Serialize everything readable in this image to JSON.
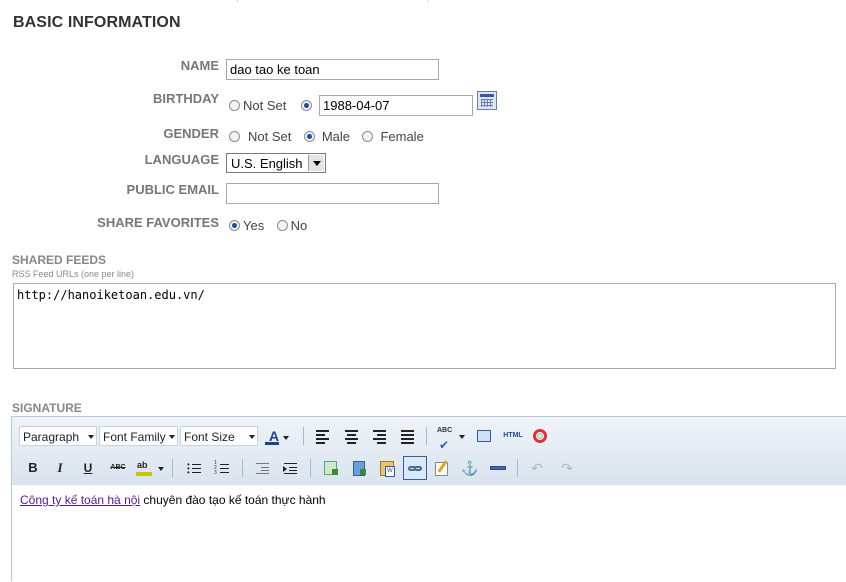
{
  "section_title": "BASIC INFORMATION",
  "form": {
    "name": {
      "label": "NAME",
      "value": "dao tao ke toan"
    },
    "birthday": {
      "label": "BIRTHDAY",
      "not_set_label": "Not Set",
      "value": "1988-04-07"
    },
    "gender": {
      "label": "GENDER",
      "options": [
        "Not Set",
        "Male",
        "Female"
      ],
      "selected": "Male"
    },
    "language": {
      "label": "LANGUAGE",
      "value": "U.S. English"
    },
    "public_email": {
      "label": "PUBLIC EMAIL",
      "value": ""
    },
    "share_favorites": {
      "label": "SHARE FAVORITES",
      "options": [
        "Yes",
        "No"
      ],
      "selected": "Yes"
    }
  },
  "shared_feeds": {
    "title": "SHARED FEEDS",
    "subtitle": "RSS Feed URLs (one per line)",
    "value": "http://hanoiketoan.edu.vn/"
  },
  "signature": {
    "title": "SIGNATURE",
    "toolbar": {
      "paragraph": "Paragraph",
      "font_family": "Font Family",
      "font_size": "Font Size",
      "icons_row1": [
        "text-color-icon",
        "align-left-icon",
        "align-center-icon",
        "align-right-icon",
        "align-justify-icon",
        "spellcheck-icon",
        "fullscreen-icon",
        "html-source-icon",
        "help-icon"
      ],
      "icons_row2": [
        "bold-icon",
        "italic-icon",
        "underline-icon",
        "strikethrough-icon",
        "highlight-icon",
        "bullet-list-icon",
        "numbered-list-icon",
        "outdent-icon",
        "indent-icon",
        "insert-image-icon",
        "insert-media-icon",
        "paste-word-icon",
        "link-icon",
        "edit-icon",
        "anchor-icon",
        "horizontal-rule-icon",
        "undo-icon",
        "redo-icon"
      ],
      "labels": {
        "bold": "B",
        "italic": "I",
        "underline": "U",
        "strike": "ABC",
        "html": "HTML",
        "abc": "ABC"
      }
    },
    "content": {
      "link_text": "Công ty kế toán hà nội",
      "rest_text": " chuyên đào tạo kế toán thực hành"
    }
  },
  "colors": {
    "label_gray": "#777777",
    "radio_blue": "#1f4e9a",
    "toolbar_bg": "#dfe8f1",
    "link": "#551a8b"
  }
}
